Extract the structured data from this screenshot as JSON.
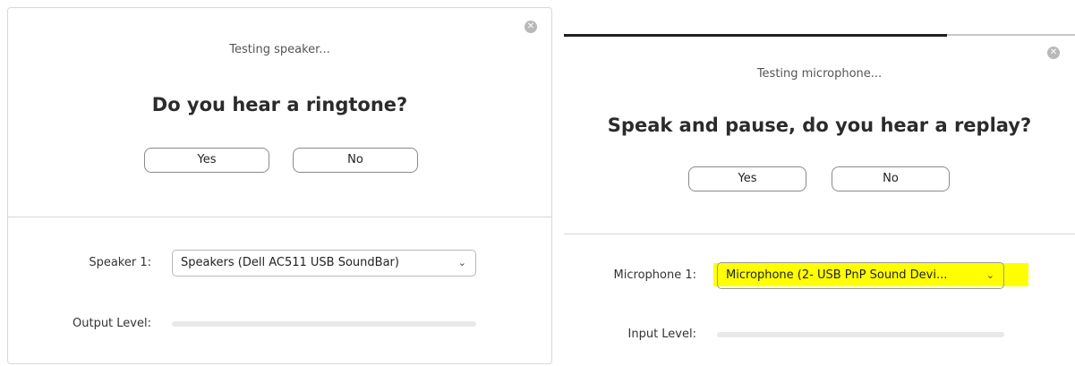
{
  "speaker_test": {
    "status": "Testing speaker...",
    "question": "Do you hear a ringtone?",
    "yes_label": "Yes",
    "no_label": "No",
    "device_label": "Speaker 1:",
    "device_value": "Speakers (Dell AC511 USB SoundBar)",
    "level_label": "Output Level:",
    "level_fraction": 0
  },
  "mic_test": {
    "status": "Testing microphone...",
    "question": "Speak and pause, do you hear a replay?",
    "yes_label": "Yes",
    "no_label": "No",
    "device_label": "Microphone 1:",
    "device_value": "Microphone (2- USB PnP Sound Devi...",
    "level_label": "Input Level:",
    "level_fraction": 0
  },
  "icons": {
    "close": "close-icon",
    "dropdown": "chevron-down-icon",
    "close_glyph": "✕",
    "chevron_glyph": "⌄"
  },
  "colors": {
    "highlight": "#ffff00",
    "level_track": "#e9e9e9"
  }
}
